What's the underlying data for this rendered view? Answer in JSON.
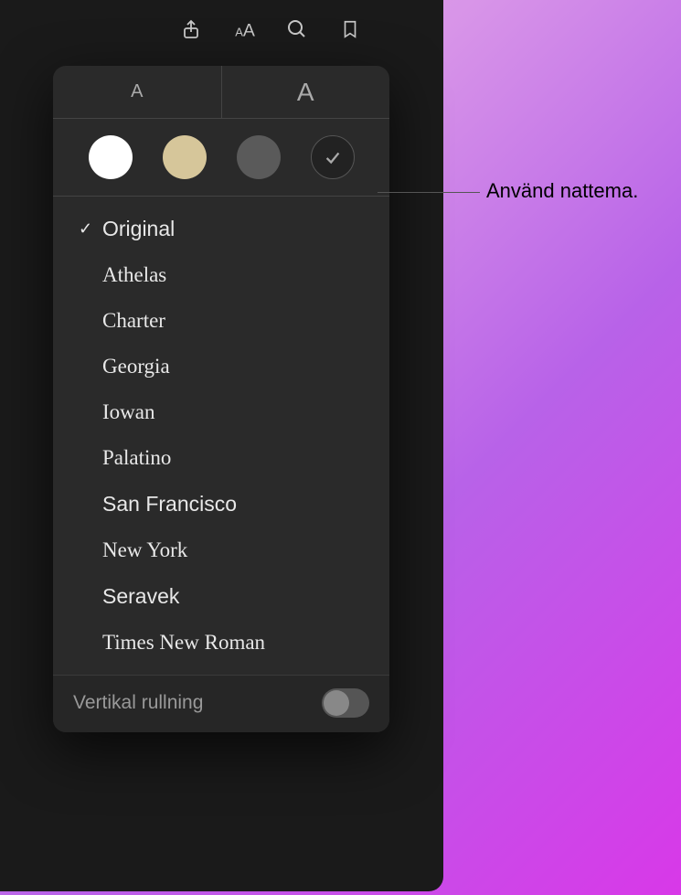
{
  "toolbar": {
    "icons": [
      "share-icon",
      "appearance-icon",
      "search-icon",
      "bookmark-icon"
    ]
  },
  "popover": {
    "size": {
      "small_glyph": "A",
      "large_glyph": "A"
    },
    "themes": [
      {
        "name": "white"
      },
      {
        "name": "sepia"
      },
      {
        "name": "gray"
      },
      {
        "name": "night",
        "selected": true
      }
    ],
    "fonts": [
      {
        "label": "Original",
        "selected": true,
        "class": "font-original"
      },
      {
        "label": "Athelas",
        "selected": false,
        "class": "font-athelas"
      },
      {
        "label": "Charter",
        "selected": false,
        "class": "font-charter"
      },
      {
        "label": "Georgia",
        "selected": false,
        "class": "font-georgia"
      },
      {
        "label": "Iowan",
        "selected": false,
        "class": "font-iowan"
      },
      {
        "label": "Palatino",
        "selected": false,
        "class": "font-palatino"
      },
      {
        "label": "San Francisco",
        "selected": false,
        "class": "font-sanfrancisco"
      },
      {
        "label": "New York",
        "selected": false,
        "class": "font-newyork"
      },
      {
        "label": "Seravek",
        "selected": false,
        "class": "font-seravek"
      },
      {
        "label": "Times New Roman",
        "selected": false,
        "class": "font-times"
      }
    ],
    "footer": {
      "vertical_scroll_label": "Vertikal rullning",
      "vertical_scroll_on": false
    }
  },
  "callout": {
    "text": "Använd nattema."
  }
}
